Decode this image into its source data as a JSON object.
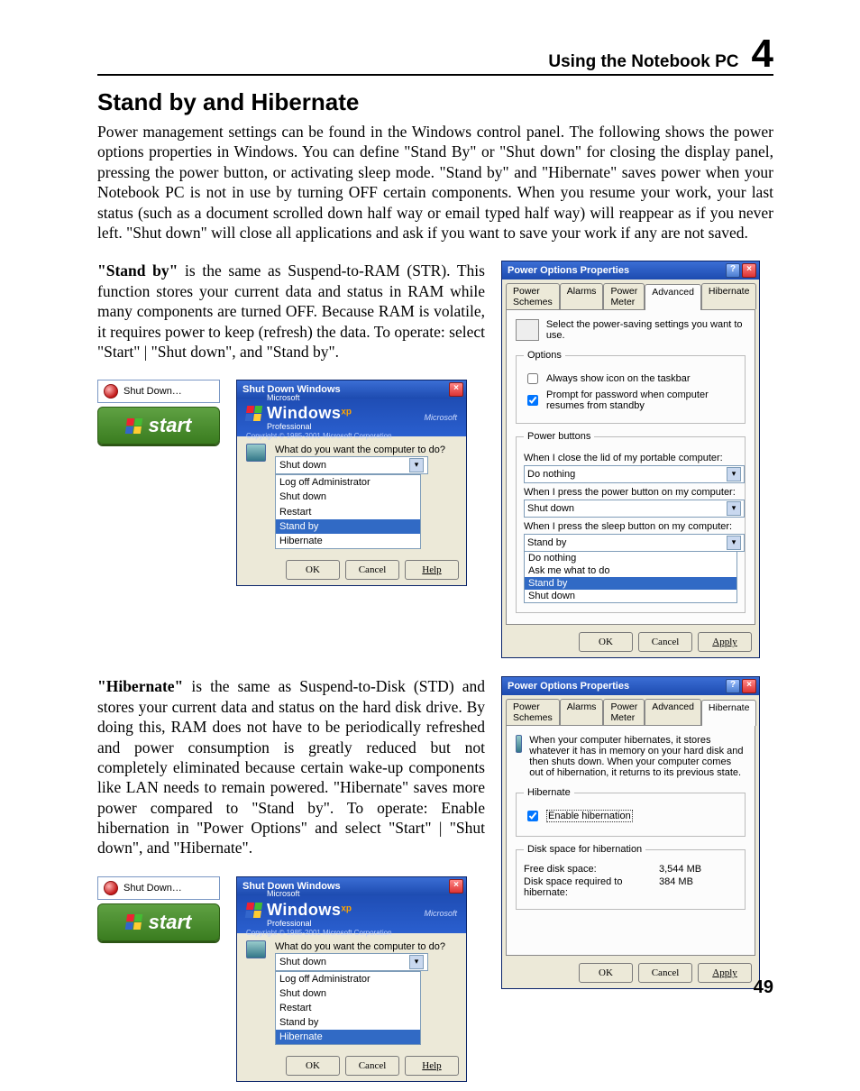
{
  "header": {
    "title": "Using the Notebook PC",
    "chapter": "4"
  },
  "page_number": "49",
  "section_title": "Stand by and Hibernate",
  "intro": "Power management settings can be found in the Windows control panel. The following shows the power options properties in Windows. You can define \"Stand By\" or \"Shut down\" for closing the display panel, pressing the power button, or activating sleep mode. \"Stand by\" and \"Hibernate\" saves power when your Notebook PC is not in use by turning OFF certain components. When you resume your work, your last status (such as a document scrolled down half way or email typed half way) will reappear as if you never left. \"Shut down\" will close all applications and ask if you want to save your work if any are not saved.",
  "standby": {
    "lead": "\"Stand by\"",
    "text": " is the same as Suspend-to-RAM (STR). This function stores your current data and status in RAM while many components are turned OFF. Because RAM is volatile, it requires power to keep (refresh) the data. To operate: select \"Start\" | \"Shut down\", and \"Stand by\"."
  },
  "hibernate": {
    "lead": "\"Hibernate\"",
    "text": " is the same as  Suspend-to-Disk (STD) and stores your current data and status on the hard disk drive. By doing this, RAM does not have to be periodically refreshed and power consumption is greatly reduced but not completely eliminated because certain wake-up components like LAN needs to remain powered. \"Hibernate\" saves more power compared to \"Stand by\". To operate: Enable hibernation in \"Power Options\" and select \"Start\" | \"Shut down\", and \"Hibernate\"."
  },
  "startmenu": {
    "shutdown_item": "Shut Down…",
    "start_label": "start"
  },
  "shutdown_win": {
    "title": "Shut Down Windows",
    "brand": "Windows",
    "brand_sup": "xp",
    "brand_sub": "Professional",
    "copyright": "Copyright © 1985-2001\nMicrosoft Corporation",
    "ms": "Microsoft",
    "prompt": "What do you want the computer to do?",
    "selected": "Shut down",
    "options_a": [
      "Log off Administrator",
      "Shut down",
      "Restart",
      "Stand by",
      "Hibernate"
    ],
    "highlight_a": "Stand by",
    "highlight_b": "Hibernate",
    "ok": "OK",
    "cancel": "Cancel",
    "help": "Help"
  },
  "power_options": {
    "title": "Power Options Properties",
    "tabs": [
      "Power Schemes",
      "Alarms",
      "Power Meter",
      "Advanced",
      "Hibernate"
    ],
    "adv": {
      "info": "Select the power-saving settings you want to use.",
      "options_legend": "Options",
      "opt1": "Always show icon on the taskbar",
      "opt2": "Prompt for password when computer resumes from standby",
      "pb_legend": "Power buttons",
      "lid_label": "When I close the lid of my portable computer:",
      "lid_sel": "Do nothing",
      "pwr_label": "When I press the power button on my computer:",
      "pwr_sel": "Shut down",
      "sleep_label": "When I press the sleep button on my computer:",
      "sleep_sel": "Stand by",
      "sleep_opts": [
        "Do nothing",
        "Ask me what to do",
        "Stand by",
        "Shut down"
      ]
    },
    "hib": {
      "info": "When your computer hibernates, it stores whatever it has in memory on your hard disk and then shuts down. When your computer comes out of hibernation, it returns to its previous state.",
      "legend": "Hibernate",
      "enable": "Enable hibernation",
      "ds_legend": "Disk space for hibernation",
      "free_label": "Free disk space:",
      "free_val": "3,544 MB",
      "req_label": "Disk space required to hibernate:",
      "req_val": "384 MB"
    },
    "ok": "OK",
    "cancel": "Cancel",
    "apply": "Apply"
  }
}
